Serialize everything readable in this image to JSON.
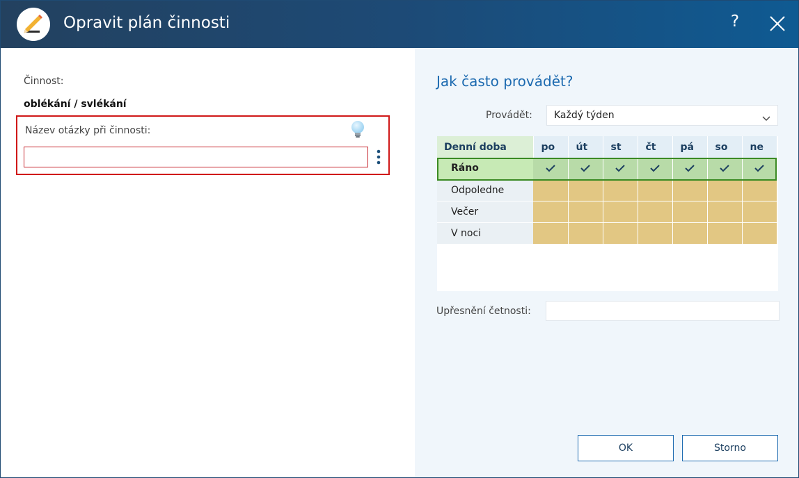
{
  "window": {
    "title": "Opravit plán činnosti",
    "help_label": "?"
  },
  "left": {
    "activity_label": "Činnost:",
    "activity_value": "oblékání / svlékání",
    "question_label": "Název otázky při činnosti:",
    "question_value": "",
    "question_placeholder": ""
  },
  "right": {
    "heading": "Jak často provádět?",
    "perform_label": "Provádět:",
    "perform_value": "Každý týden",
    "table": {
      "header": "Denní doba",
      "days": [
        "po",
        "út",
        "st",
        "čt",
        "pá",
        "so",
        "ne"
      ],
      "rows": [
        {
          "label": "Ráno",
          "selected": true,
          "checked": [
            true,
            true,
            true,
            true,
            true,
            true,
            true
          ]
        },
        {
          "label": "Odpoledne",
          "selected": false,
          "checked": [
            false,
            false,
            false,
            false,
            false,
            false,
            false
          ]
        },
        {
          "label": "Večer",
          "selected": false,
          "checked": [
            false,
            false,
            false,
            false,
            false,
            false,
            false
          ]
        },
        {
          "label": "V noci",
          "selected": false,
          "checked": [
            false,
            false,
            false,
            false,
            false,
            false,
            false
          ]
        }
      ]
    },
    "frequency_label": "Upřesnění četnosti:",
    "frequency_value": ""
  },
  "buttons": {
    "ok_label": "OK",
    "cancel_label": "Storno"
  },
  "colors": {
    "title_bar": "#1d4a76",
    "accent": "#1c6ab0",
    "highlight_border": "#d01818",
    "cell_unselected": "#e2c783",
    "row_selected": "#c7eab5",
    "selection_outline": "#3a8a23"
  },
  "icons": {
    "app": "pencil-icon",
    "help": "help-icon",
    "close": "close-icon",
    "hint": "lightbulb-icon",
    "more": "kebab-menu-icon",
    "dropdown": "chevron-down-icon",
    "check": "checkmark-icon"
  }
}
